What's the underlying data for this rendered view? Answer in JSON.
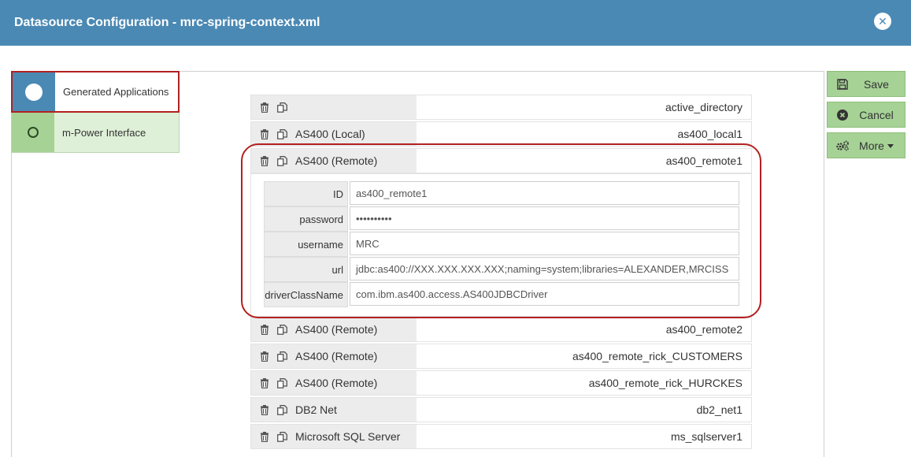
{
  "window": {
    "title": "Datasource Configuration - mrc-spring-context.xml"
  },
  "nav": {
    "items": [
      {
        "label": "Generated Applications",
        "state": "active"
      },
      {
        "label": "m-Power Interface",
        "state": "inactive"
      }
    ]
  },
  "datasources": [
    {
      "type": "",
      "id": "active_directory"
    },
    {
      "type": "AS400 (Local)",
      "id": "as400_local1"
    },
    {
      "type": "AS400 (Remote)",
      "id": "as400_remote1",
      "expanded": true
    },
    {
      "type": "AS400 (Remote)",
      "id": "as400_remote2"
    },
    {
      "type": "AS400 (Remote)",
      "id": "as400_remote_rick_CUSTOMERS"
    },
    {
      "type": "AS400 (Remote)",
      "id": "as400_remote_rick_HURCKES"
    },
    {
      "type": "DB2 Net",
      "id": "db2_net1"
    },
    {
      "type": "Microsoft SQL Server",
      "id": "ms_sqlserver1"
    }
  ],
  "detail": {
    "fields": [
      {
        "label": "ID",
        "value": "as400_remote1"
      },
      {
        "label": "password",
        "value": "••••••••••"
      },
      {
        "label": "username",
        "value": "MRC"
      },
      {
        "label": "url",
        "value": "jdbc:as400://XXX.XXX.XXX.XXX;naming=system;libraries=ALEXANDER,MRCISS"
      },
      {
        "label": "driverClassName",
        "value": "com.ibm.as400.access.AS400JDBCDriver"
      }
    ]
  },
  "actions": {
    "save_label": "Save",
    "cancel_label": "Cancel",
    "more_label": "More"
  },
  "icons": {
    "close": "close-icon",
    "delete": "trash-icon",
    "copy": "copy-icon",
    "save": "floppy-icon",
    "cancel": "cancel-icon",
    "more": "gears-icon"
  },
  "colors": {
    "titlebar": "#4a89b4",
    "active_nav": "#4a89b4",
    "green_button": "#a6d296",
    "highlight": "#b32020"
  }
}
